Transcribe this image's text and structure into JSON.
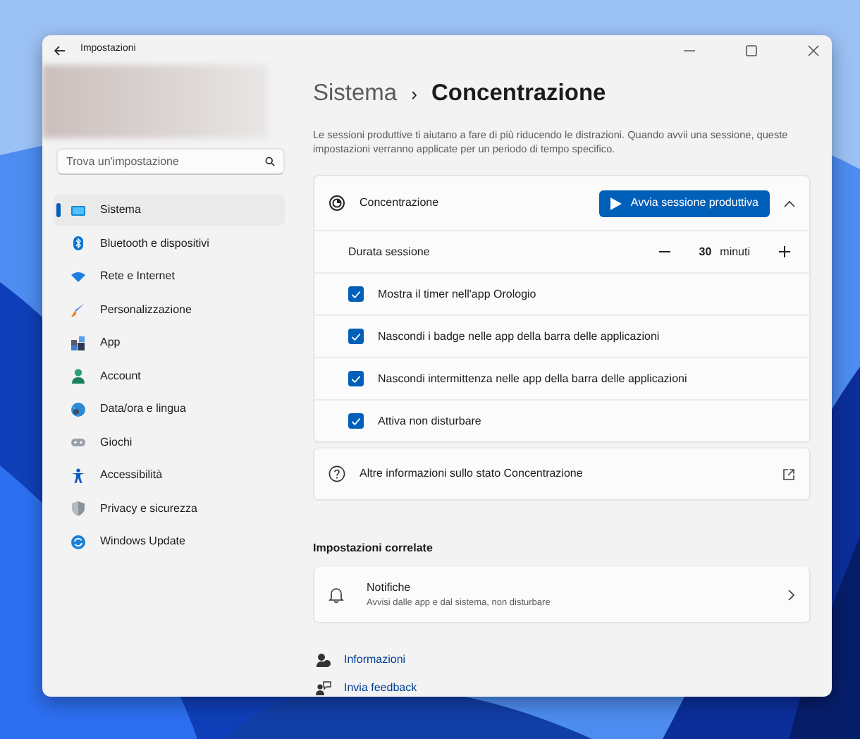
{
  "window": {
    "title": "Impostazioni"
  },
  "search": {
    "placeholder": "Trova un'impostazione"
  },
  "sidebar": {
    "items": [
      {
        "label": "Sistema",
        "selected": true
      },
      {
        "label": "Bluetooth e dispositivi",
        "selected": false
      },
      {
        "label": "Rete e Internet",
        "selected": false
      },
      {
        "label": "Personalizzazione",
        "selected": false
      },
      {
        "label": "App",
        "selected": false
      },
      {
        "label": "Account",
        "selected": false
      },
      {
        "label": "Data/ora e lingua",
        "selected": false
      },
      {
        "label": "Giochi",
        "selected": false
      },
      {
        "label": "Accessibilità",
        "selected": false
      },
      {
        "label": "Privacy e sicurezza",
        "selected": false
      },
      {
        "label": "Windows Update",
        "selected": false
      }
    ]
  },
  "breadcrumb": {
    "parent": "Sistema",
    "separator": "›",
    "current": "Concentrazione"
  },
  "description": "Le sessioni produttive ti aiutano a fare di più riducendo le distrazioni. Quando avvii una sessione, queste impostazioni verranno applicate per un periodo di tempo specifico.",
  "focus_card": {
    "title": "Concentrazione",
    "start_button": "Avvia sessione produttiva",
    "expanded": true,
    "duration": {
      "label": "Durata sessione",
      "value": "30",
      "unit": "minuti"
    },
    "options": [
      {
        "label": "Mostra il timer nell'app Orologio",
        "checked": true
      },
      {
        "label": "Nascondi i badge nelle app della barra delle applicazioni",
        "checked": true
      },
      {
        "label": "Nascondi intermittenza nelle app della barra delle applicazioni",
        "checked": true
      },
      {
        "label": "Attiva non disturbare",
        "checked": true
      }
    ]
  },
  "info_link": "Altre informazioni sullo stato Concentrazione",
  "related": {
    "heading": "Impostazioni correlate",
    "items": [
      {
        "title": "Notifiche",
        "subtitle": "Avvisi dalle app e dal sistema, non disturbare"
      }
    ]
  },
  "footer_links": [
    "Informazioni",
    "Invia feedback"
  ]
}
